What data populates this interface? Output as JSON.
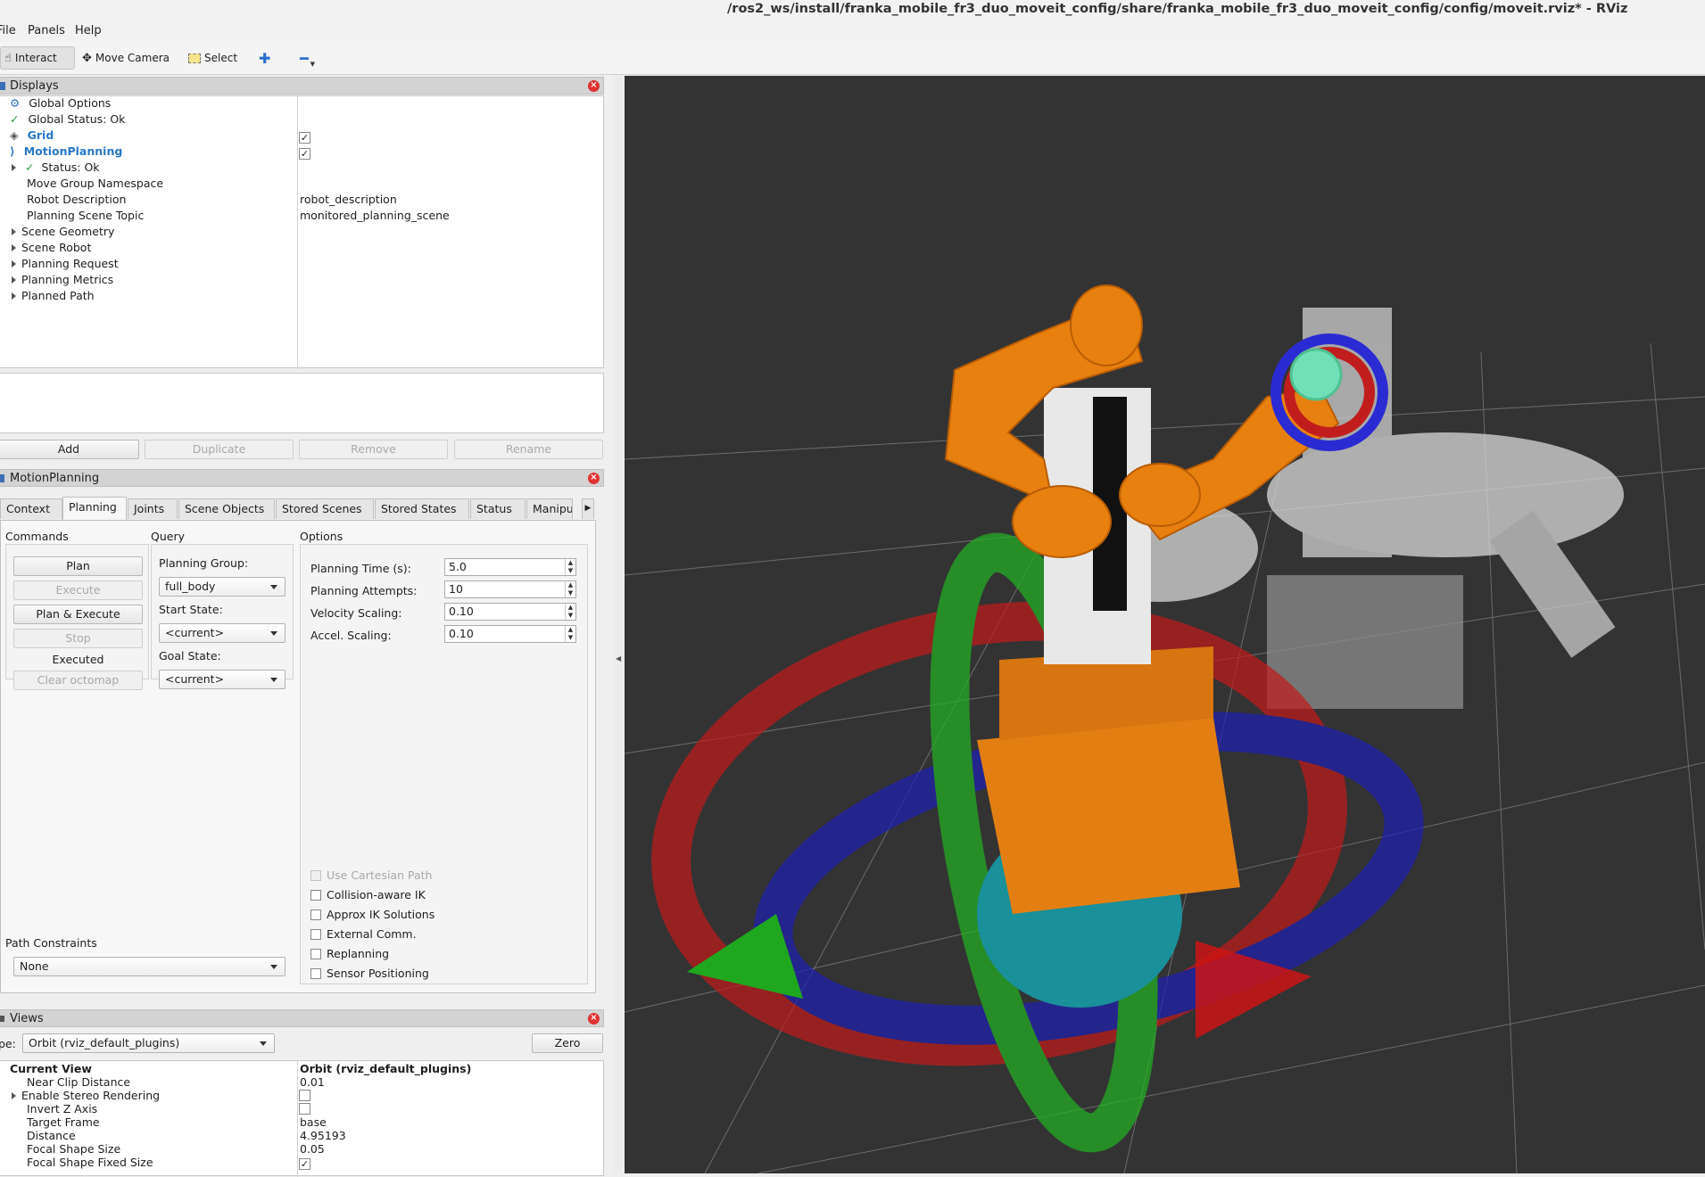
{
  "window": {
    "title": "/ros2_ws/install/franka_mobile_fr3_duo_moveit_config/share/franka_mobile_fr3_duo_moveit_config/config/moveit.rviz* - RViz"
  },
  "menu": {
    "items": [
      "File",
      "Panels",
      "Help"
    ]
  },
  "toolbar": {
    "interact": "Interact",
    "move_camera": "Move Camera",
    "select": "Select"
  },
  "displays": {
    "title": "Displays",
    "rows": [
      {
        "name": "Global Options",
        "value": ""
      },
      {
        "name": "Global Status: Ok",
        "value": ""
      },
      {
        "name": "Grid",
        "value": ""
      },
      {
        "name": "MotionPlanning",
        "value": ""
      },
      {
        "name": "Status: Ok",
        "value": ""
      },
      {
        "name": "Move Group Namespace",
        "value": ""
      },
      {
        "name": "Robot Description",
        "value": "robot_description"
      },
      {
        "name": "Planning Scene Topic",
        "value": "monitored_planning_scene"
      },
      {
        "name": "Scene Geometry",
        "value": ""
      },
      {
        "name": "Scene Robot",
        "value": ""
      },
      {
        "name": "Planning Request",
        "value": ""
      },
      {
        "name": "Planning Metrics",
        "value": ""
      },
      {
        "name": "Planned Path",
        "value": ""
      }
    ],
    "buttons": {
      "add": "Add",
      "duplicate": "Duplicate",
      "remove": "Remove",
      "rename": "Rename"
    }
  },
  "motion_planning": {
    "title": "MotionPlanning",
    "tabs": [
      "Context",
      "Planning",
      "Joints",
      "Scene Objects",
      "Stored Scenes",
      "Stored States",
      "Status",
      "Manipu"
    ],
    "commands": {
      "header": "Commands",
      "plan": "Plan",
      "execute": "Execute",
      "plan_execute": "Plan & Execute",
      "stop": "Stop",
      "status": "Executed",
      "clear_octomap": "Clear octomap"
    },
    "query": {
      "header": "Query",
      "planning_group_label": "Planning Group:",
      "planning_group": "full_body",
      "start_state_label": "Start State:",
      "start_state": "<current>",
      "goal_state_label": "Goal State:",
      "goal_state": "<current>"
    },
    "options": {
      "header": "Options",
      "planning_time_label": "Planning Time (s):",
      "planning_time": "5.0",
      "planning_attempts_label": "Planning Attempts:",
      "planning_attempts": "10",
      "velocity_label": "Velocity Scaling:",
      "velocity": "0.10",
      "accel_label": "Accel. Scaling:",
      "accel": "0.10",
      "checkboxes": [
        {
          "label": "Use Cartesian Path",
          "disabled": true
        },
        {
          "label": "Collision-aware IK",
          "disabled": false
        },
        {
          "label": "Approx IK Solutions",
          "disabled": false
        },
        {
          "label": "External Comm.",
          "disabled": false
        },
        {
          "label": "Replanning",
          "disabled": false
        },
        {
          "label": "Sensor Positioning",
          "disabled": false
        }
      ]
    },
    "path_constraints": {
      "label": "Path Constraints",
      "value": "None"
    }
  },
  "views": {
    "title": "Views",
    "type_label": "pe:",
    "type_value": "Orbit (rviz_default_plugins)",
    "zero": "Zero",
    "rows": [
      {
        "name": "Current View",
        "value": "Orbit (rviz_default_plugins)"
      },
      {
        "name": "Near Clip Distance",
        "value": "0.01"
      },
      {
        "name": "Enable Stereo Rendering",
        "value": ""
      },
      {
        "name": "Invert Z Axis",
        "value": ""
      },
      {
        "name": "Target Frame",
        "value": "base"
      },
      {
        "name": "Distance",
        "value": "4.95193"
      },
      {
        "name": "Focal Shape Size",
        "value": "0.05"
      },
      {
        "name": "Focal Shape Fixed Size",
        "value": ""
      }
    ]
  },
  "colors": {
    "viewport_bg": "#333333",
    "accent_blue": "#2979c9",
    "robot_orange": "#e8800f"
  }
}
